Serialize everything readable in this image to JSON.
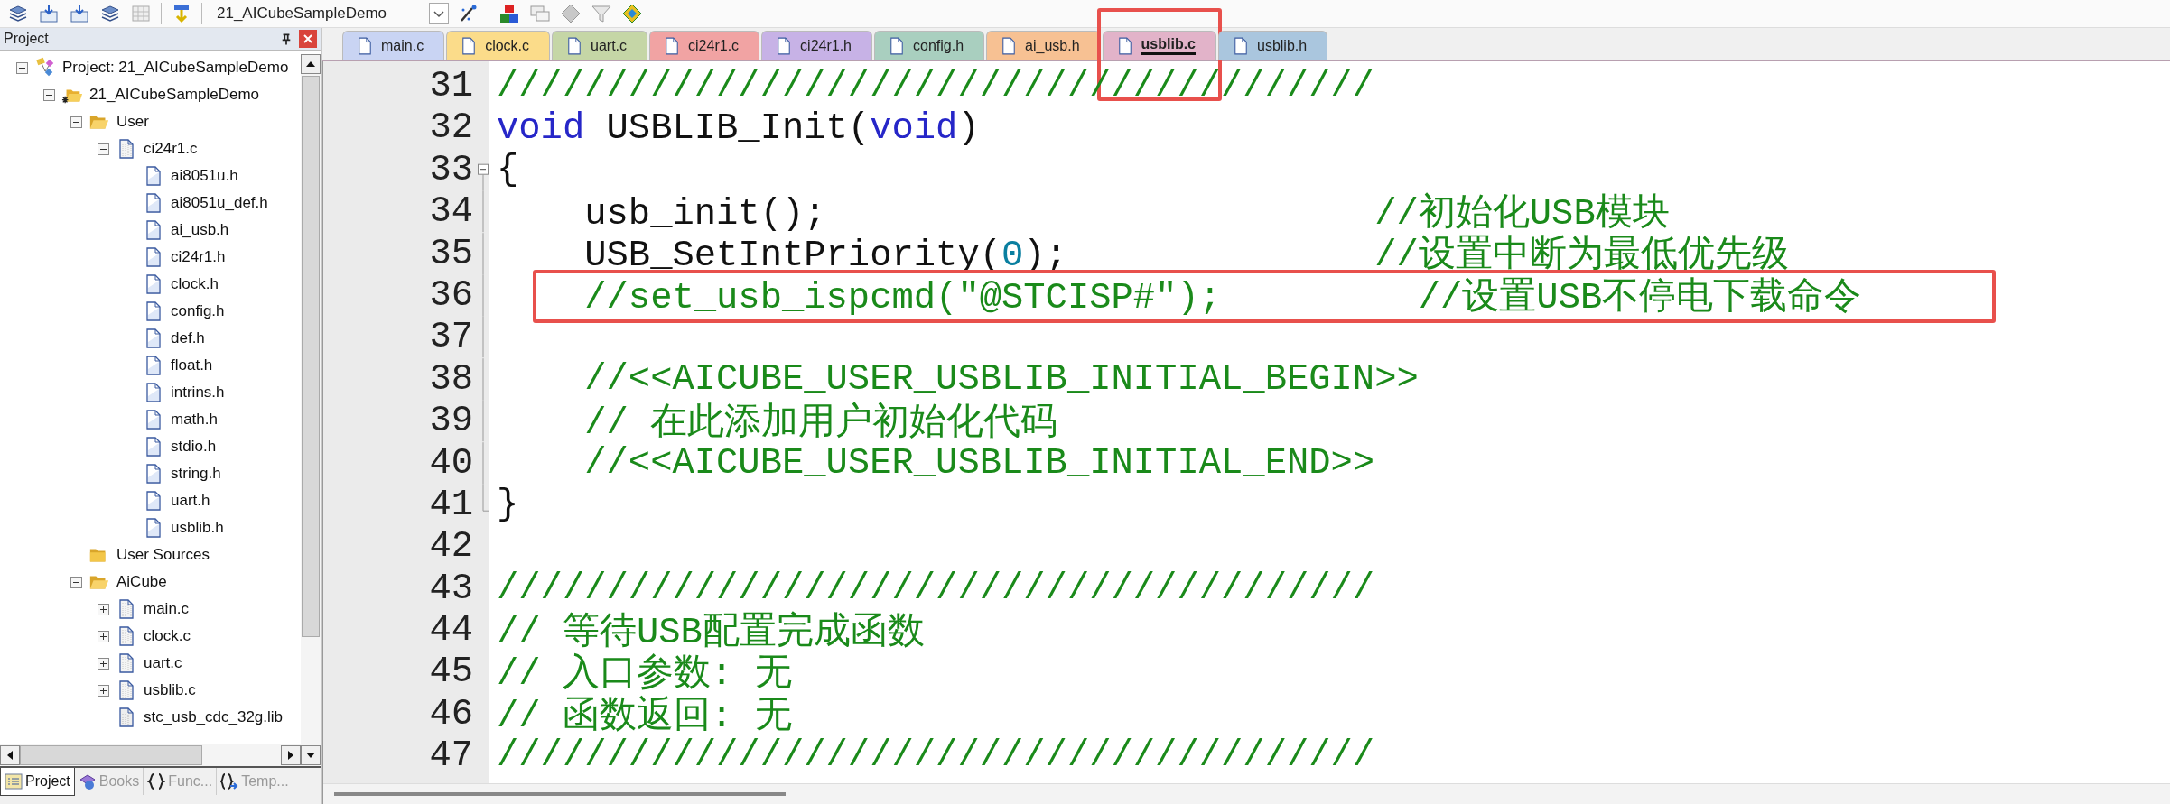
{
  "toolbar": {
    "target": "21_AICubeSampleDemo"
  },
  "project_panel": {
    "title": "Project",
    "tree": [
      {
        "kind": "project",
        "label": "Project: 21_AICubeSampleDemo",
        "expanded": true,
        "children": [
          {
            "kind": "target",
            "label": "21_AICubeSampleDemo",
            "expanded": true,
            "children": [
              {
                "kind": "folder",
                "label": "User",
                "expanded": true,
                "children": [
                  {
                    "kind": "source",
                    "label": "ci24r1.c",
                    "expanded": true,
                    "children": [
                      {
                        "kind": "header",
                        "label": "ai8051u.h"
                      },
                      {
                        "kind": "header",
                        "label": "ai8051u_def.h"
                      },
                      {
                        "kind": "header",
                        "label": "ai_usb.h"
                      },
                      {
                        "kind": "header",
                        "label": "ci24r1.h"
                      },
                      {
                        "kind": "header",
                        "label": "clock.h"
                      },
                      {
                        "kind": "header",
                        "label": "config.h"
                      },
                      {
                        "kind": "header",
                        "label": "def.h"
                      },
                      {
                        "kind": "header",
                        "label": "float.h"
                      },
                      {
                        "kind": "header",
                        "label": "intrins.h"
                      },
                      {
                        "kind": "header",
                        "label": "math.h"
                      },
                      {
                        "kind": "header",
                        "label": "stdio.h"
                      },
                      {
                        "kind": "header",
                        "label": "string.h"
                      },
                      {
                        "kind": "header",
                        "label": "uart.h"
                      },
                      {
                        "kind": "header",
                        "label": "usblib.h"
                      }
                    ]
                  }
                ]
              },
              {
                "kind": "folder",
                "label": "User Sources"
              },
              {
                "kind": "folder",
                "label": "AiCube",
                "expanded": true,
                "children": [
                  {
                    "kind": "source",
                    "label": "main.c",
                    "expanded": false
                  },
                  {
                    "kind": "source",
                    "label": "clock.c",
                    "expanded": false
                  },
                  {
                    "kind": "source",
                    "label": "uart.c",
                    "expanded": false
                  },
                  {
                    "kind": "source",
                    "label": "usblib.c",
                    "expanded": false
                  },
                  {
                    "kind": "library",
                    "label": "stc_usb_cdc_32g.lib"
                  }
                ]
              }
            ]
          }
        ]
      }
    ],
    "bottom_tabs": [
      {
        "kind": "project",
        "label": "Project",
        "selected": true
      },
      {
        "kind": "books",
        "label": "Books",
        "selected": false
      },
      {
        "kind": "functions",
        "label": "Func...",
        "selected": false
      },
      {
        "kind": "templates",
        "label": "Temp...",
        "selected": false
      }
    ]
  },
  "editor": {
    "tabs": [
      {
        "label": "main.c",
        "color": "#c9d4f3",
        "selected": false,
        "highlighted": false
      },
      {
        "label": "clock.c",
        "color": "#fbdc8a",
        "selected": false,
        "highlighted": false
      },
      {
        "label": "uart.c",
        "color": "#c5d6a6",
        "selected": false,
        "highlighted": false
      },
      {
        "label": "ci24r1.c",
        "color": "#f1a3a3",
        "selected": false,
        "highlighted": false
      },
      {
        "label": "ci24r1.h",
        "color": "#c7b2e6",
        "selected": false,
        "highlighted": false
      },
      {
        "label": "config.h",
        "color": "#a9cfbf",
        "selected": false,
        "highlighted": false
      },
      {
        "label": "ai_usb.h",
        "color": "#f7c193",
        "selected": false,
        "highlighted": false
      },
      {
        "label": "usblib.c",
        "color": "#e2b3c9",
        "selected": true,
        "highlighted": true
      },
      {
        "label": "usblib.h",
        "color": "#aac6de",
        "selected": false,
        "highlighted": false
      }
    ],
    "lines": [
      {
        "number": "31",
        "highlighted": false,
        "tokens": [
          {
            "kind": "comment",
            "text": "////////////////////////////////////////"
          }
        ]
      },
      {
        "number": "32",
        "highlighted": false,
        "tokens": [
          {
            "kind": "keyword",
            "text": "void"
          },
          {
            "kind": "plain",
            "text": " USBLIB_Init("
          },
          {
            "kind": "keyword",
            "text": "void"
          },
          {
            "kind": "plain",
            "text": ")"
          }
        ]
      },
      {
        "number": "33",
        "highlighted": false,
        "kind": "opener",
        "tokens": [
          {
            "kind": "plain",
            "text": "{"
          }
        ]
      },
      {
        "number": "34",
        "highlighted": false,
        "kind": "inside",
        "tokens": [
          {
            "kind": "plain",
            "text": "    usb_init();                         "
          },
          {
            "kind": "comment",
            "text": "//初始化USB模块"
          }
        ]
      },
      {
        "number": "35",
        "highlighted": false,
        "kind": "inside",
        "tokens": [
          {
            "kind": "plain",
            "text": "    USB_SetIntPriority("
          },
          {
            "kind": "number",
            "text": "0"
          },
          {
            "kind": "plain",
            "text": ");              "
          },
          {
            "kind": "comment",
            "text": "//设置中断为最低优先级"
          }
        ]
      },
      {
        "number": "36",
        "highlighted": true,
        "kind": "inside",
        "tokens": [
          {
            "kind": "comment",
            "text": "    //set_usb_ispcmd(\"@STCISP#\");         //设置USB不停电下载命令"
          }
        ]
      },
      {
        "number": "37",
        "highlighted": false,
        "kind": "inside"
      },
      {
        "number": "38",
        "highlighted": false,
        "kind": "inside",
        "tokens": [
          {
            "kind": "comment",
            "text": "    //<<AICUBE_USER_USBLIB_INITIAL_BEGIN>>"
          }
        ]
      },
      {
        "number": "39",
        "highlighted": false,
        "kind": "inside",
        "tokens": [
          {
            "kind": "comment",
            "text": "    // 在此添加用户初始化代码"
          }
        ]
      },
      {
        "number": "40",
        "highlighted": false,
        "kind": "inside",
        "tokens": [
          {
            "kind": "comment",
            "text": "    //<<AICUBE_USER_USBLIB_INITIAL_END>>"
          }
        ]
      },
      {
        "number": "41",
        "highlighted": false,
        "kind": "closer",
        "tokens": [
          {
            "kind": "plain",
            "text": "}"
          }
        ]
      },
      {
        "number": "42",
        "highlighted": false
      },
      {
        "number": "43",
        "highlighted": false,
        "tokens": [
          {
            "kind": "comment",
            "text": "////////////////////////////////////////"
          }
        ]
      },
      {
        "number": "44",
        "highlighted": false,
        "tokens": [
          {
            "kind": "comment",
            "text": "// 等待USB配置完成函数"
          }
        ]
      },
      {
        "number": "45",
        "highlighted": false,
        "tokens": [
          {
            "kind": "comment",
            "text": "// 入口参数: 无"
          }
        ]
      },
      {
        "number": "46",
        "highlighted": false,
        "tokens": [
          {
            "kind": "comment",
            "text": "// 函数返回: 无"
          }
        ]
      },
      {
        "number": "47",
        "highlighted": false,
        "tokens": [
          {
            "kind": "comment",
            "text": "////////////////////////////////////////"
          }
        ]
      }
    ]
  }
}
